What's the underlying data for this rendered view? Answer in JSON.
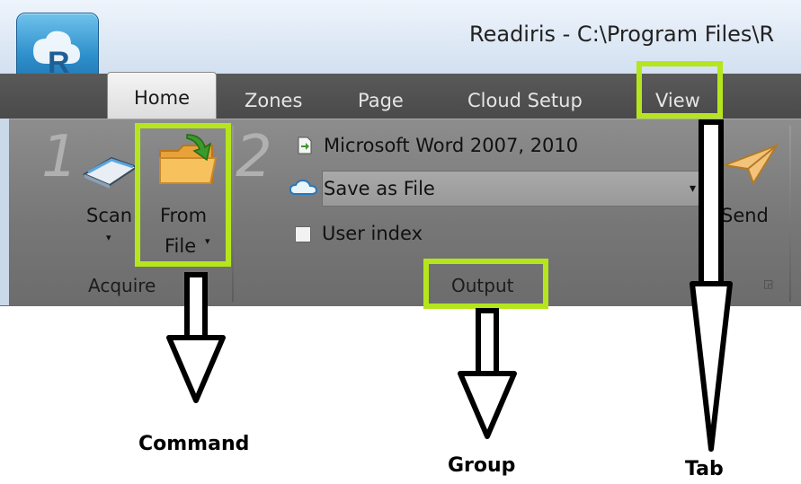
{
  "window": {
    "title": "Readiris - C:\\Program Files\\R"
  },
  "tabs": [
    {
      "label": "Home",
      "active": true
    },
    {
      "label": "Zones",
      "active": false
    },
    {
      "label": "Page",
      "active": false
    },
    {
      "label": "Cloud Setup",
      "active": false
    },
    {
      "label": "View",
      "active": false
    }
  ],
  "acquire_group": {
    "step": "1",
    "scan_label": "Scan",
    "from_label": "From",
    "file_label": "File",
    "group_label": "Acquire"
  },
  "output_group": {
    "step": "2",
    "format_label": "Microsoft Word 2007, 2010",
    "save_as_value": "Save as File",
    "user_index_label": "User index",
    "user_index_checked": false,
    "send_label": "Send",
    "group_label": "Output"
  },
  "annotations": {
    "command": "Command",
    "group": "Group",
    "tab": "Tab"
  },
  "colors": {
    "highlight": "#b5e61d",
    "ribbon": "#777777",
    "tabbar": "#4d4d4d"
  },
  "icons": [
    "readiris-logo-icon",
    "scanner-icon",
    "open-folder-icon",
    "document-arrow-icon",
    "cloud-icon",
    "paper-plane-icon",
    "dialog-launcher-icon"
  ]
}
